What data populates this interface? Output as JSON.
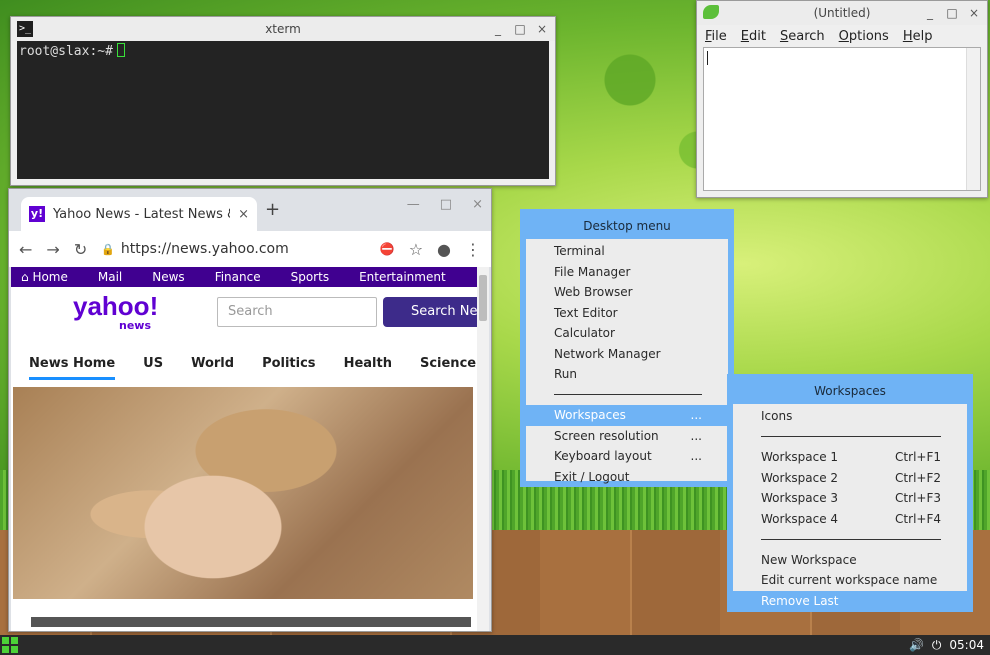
{
  "xterm": {
    "title": "xterm",
    "icon": "terminal-icon",
    "prompt": "root@slax:~#",
    "btn_min": "_",
    "btn_max": "□",
    "btn_close": "×"
  },
  "editor": {
    "title": "(Untitled)",
    "icon": "leafpad-icon",
    "menu": [
      "File",
      "Edit",
      "Search",
      "Options",
      "Help"
    ],
    "btn_min": "_",
    "btn_max": "□",
    "btn_close": "×"
  },
  "browser": {
    "tab_favicon": "y!",
    "tab_title": "Yahoo News - Latest News & Headlines",
    "tab_close": "×",
    "new_tab": "+",
    "btn_min": "—",
    "btn_max": "□",
    "btn_close": "×",
    "url": "https://news.yahoo.com",
    "nav_back": "←",
    "nav_forward": "→",
    "nav_reload": "↻",
    "lock": "🔒",
    "ext_icon": "⛔",
    "star": "☆",
    "profile": "●",
    "kebab": "⋮",
    "yahoo_nav": [
      "Home",
      "Mail",
      "News",
      "Finance",
      "Sports",
      "Entertainment"
    ],
    "logo_main": "yahoo!",
    "logo_sub": "news",
    "search_placeholder": "Search",
    "search_button": "Search News",
    "subnav": [
      "News Home",
      "US",
      "World",
      "Politics",
      "Health",
      "Science"
    ]
  },
  "desktop_menu": {
    "title": "Desktop menu",
    "items": [
      {
        "label": "Terminal",
        "right": ""
      },
      {
        "label": "File Manager",
        "right": ""
      },
      {
        "label": "Web Browser",
        "right": ""
      },
      {
        "label": "Text Editor",
        "right": ""
      },
      {
        "label": "Calculator",
        "right": ""
      },
      {
        "label": "Network Manager",
        "right": ""
      },
      {
        "label": "Run",
        "right": ""
      },
      {
        "label": "",
        "right": ""
      },
      {
        "label": "Workspaces",
        "right": "..."
      },
      {
        "label": "Screen resolution",
        "right": "..."
      },
      {
        "label": "Keyboard layout",
        "right": "..."
      },
      {
        "label": "Exit / Logout",
        "right": ""
      }
    ]
  },
  "workspaces_menu": {
    "title": "Workspaces",
    "items": [
      {
        "label": "Icons",
        "right": ""
      },
      {
        "label": "",
        "right": ""
      },
      {
        "label": "Workspace 1",
        "right": "Ctrl+F1"
      },
      {
        "label": "Workspace 2",
        "right": "Ctrl+F2"
      },
      {
        "label": "Workspace 3",
        "right": "Ctrl+F3"
      },
      {
        "label": "Workspace 4",
        "right": "Ctrl+F4"
      },
      {
        "label": "",
        "right": ""
      },
      {
        "label": "New Workspace",
        "right": ""
      },
      {
        "label": "Edit current workspace name",
        "right": ""
      },
      {
        "label": "Remove Last",
        "right": ""
      }
    ]
  },
  "taskbar": {
    "volume": "🔊",
    "power": "⏻",
    "clock": "05:04"
  }
}
